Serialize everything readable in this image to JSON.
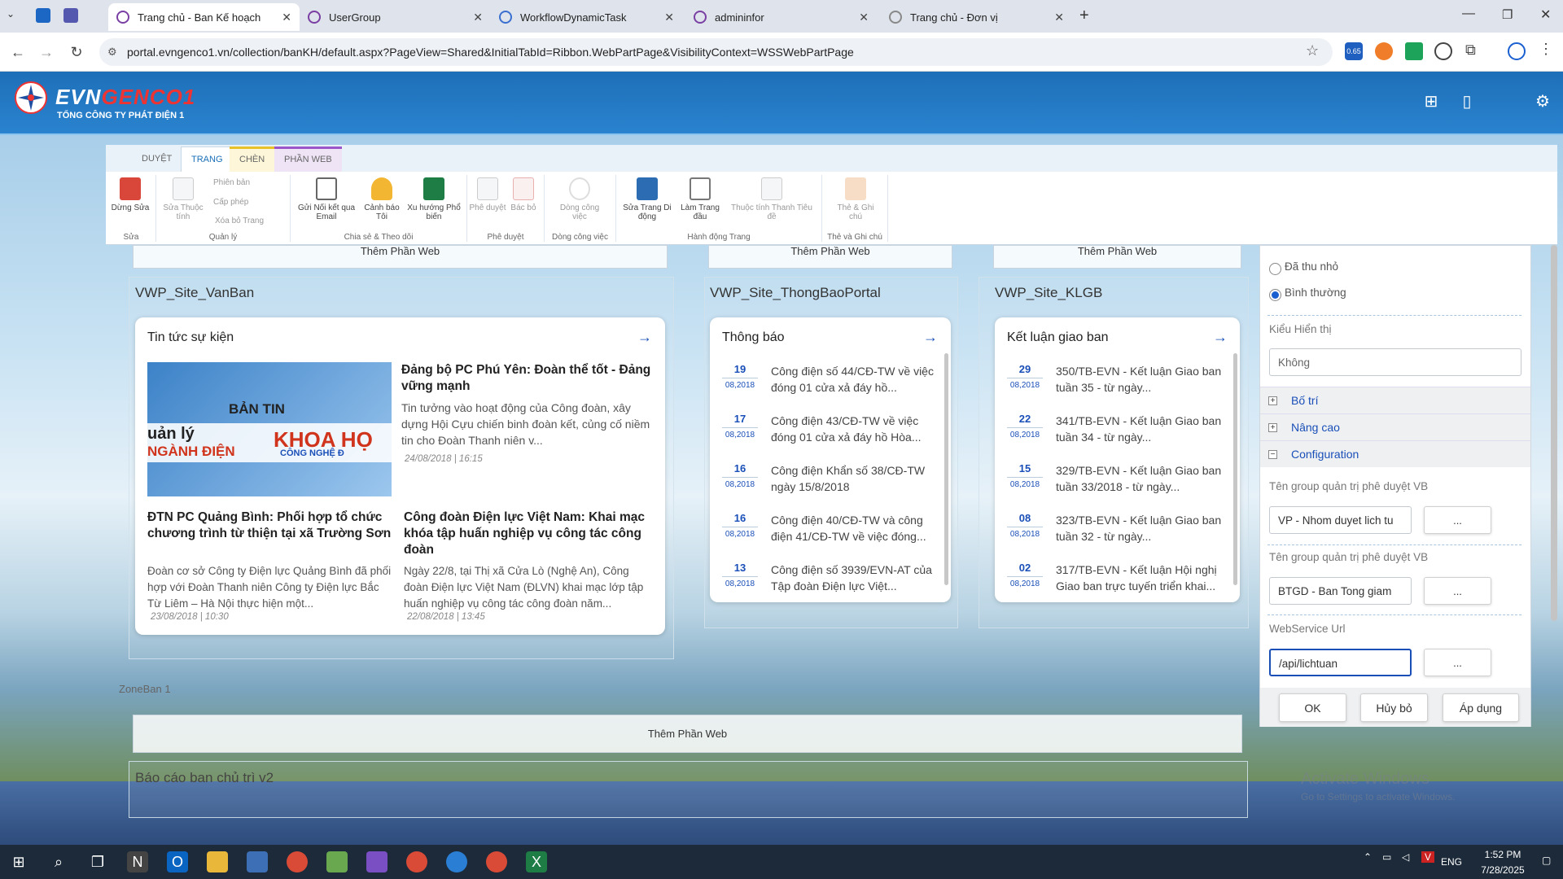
{
  "browser": {
    "tabs": [
      {
        "title": "Trang chủ - Ban Kế hoạch",
        "active": true
      },
      {
        "title": "UserGroup"
      },
      {
        "title": "WorkflowDynamicTask"
      },
      {
        "title": "admininfor"
      },
      {
        "title": "Trang chủ - Đơn vị"
      }
    ],
    "url": "portal.evngenco1.vn/collection/banKH/default.aspx?PageView=Shared&InitialTabId=Ribbon.WebPartPage&VisibilityContext=WSSWebPartPage",
    "ext_badge": "0.65"
  },
  "site": {
    "brand_a": "EVN",
    "brand_b": "GENCO1",
    "subtitle": "TỔNG CÔNG TY PHÁT ĐIỆN 1"
  },
  "ribbon": {
    "tabs": [
      "DUYỆT",
      "TRANG",
      "CHÈN",
      "PHẦN WEB"
    ],
    "buttons": {
      "stop_edit": "Dừng Sửa",
      "edit_props": "Sửa Thuộc tính",
      "version": "Phiên bản",
      "permission": "Cấp phép",
      "delete_page": "Xóa bỏ Trang",
      "email_link": "Gửi Nối kết qua Email",
      "alert_me": "Cảnh báo Tôi",
      "excel_pop": "Xu hướng Phổ biến",
      "approve": "Phê duyệt",
      "reject": "Bác bỏ",
      "workflow": "Dòng công việc",
      "edit_mobile": "Sửa Trang Di động",
      "make_home": "Làm Trang đầu",
      "title_bar": "Thuộc tính Thanh Tiêu đề",
      "tags_notes": "Thẻ & Ghi chú"
    },
    "groups": {
      "edit": "Sửa",
      "manage": "Quản lý",
      "share": "Chia sẻ & Theo dõi",
      "approval": "Phê duyệt",
      "workflow": "Dòng công việc",
      "page_actions": "Hành động Trang",
      "tags": "Thẻ và Ghi chú"
    }
  },
  "content": {
    "add_webpart": "Thêm Phần Web",
    "zone_label": "ZoneBan 1",
    "bottom_zone_title": "Báo cáo ban chủ trì v2",
    "vanban": {
      "zone_title": "VWP_Site_VanBan",
      "card_title": "Tin tức sự kiện",
      "banner_top": "BẢN TIN",
      "banner_left_1": "uản lý",
      "banner_left_2": "NGÀNH ĐIỆN",
      "banner_right_1": "KHOA HỌ",
      "banner_right_2": "CÔNG NGHỆ Đ",
      "featured": {
        "title": "Đảng bộ PC Phú Yên: Đoàn thể tốt - Đảng vững mạnh",
        "summary": "Tin tưởng vào hoạt động của Công đoàn, xây dựng Hội Cựu chiến binh đoàn kết, củng cố niềm tin cho Đoàn Thanh niên v...",
        "date": "24/08/2018 | 16:15"
      },
      "news": [
        {
          "title": "ĐTN PC Quảng Bình: Phối hợp tổ chức chương trình từ thiện tại xã Trường Sơn",
          "summary": "Đoàn cơ sở Công ty Điện lực Quảng Bình đã phối hợp với Đoàn Thanh niên Công ty Điện lực Bắc Từ Liêm – Hà Nội thực hiện một...",
          "date": "23/08/2018 | 10:30"
        },
        {
          "title": "Công đoàn Điện lực Việt Nam: Khai mạc khóa tập huấn nghiệp vụ công tác công đoàn",
          "summary": "Ngày 22/8, tại Thị xã Cửa Lò (Nghệ An), Công đoàn Điện lực Việt Nam (ĐLVN) khai mạc lớp tập huấn nghiệp vụ công tác công đoàn năm...",
          "date": "22/08/2018 | 13:45"
        }
      ]
    },
    "thongbao": {
      "zone_title": "VWP_Site_ThongBaoPortal",
      "card_title": "Thông báo",
      "items": [
        {
          "day": "19",
          "month": "08,2018",
          "text": "Công điện số 44/CĐ-TW về việc đóng 01 cửa xả đáy hồ..."
        },
        {
          "day": "17",
          "month": "08,2018",
          "text": "Công điện 43/CĐ-TW về việc đóng 01 cửa xả đáy hồ Hòa..."
        },
        {
          "day": "16",
          "month": "08,2018",
          "text": "Công điện Khẩn số 38/CĐ-TW ngày 15/8/2018"
        },
        {
          "day": "16",
          "month": "08,2018",
          "text": "Công điện 40/CĐ-TW và công điện 41/CĐ-TW về việc đóng..."
        },
        {
          "day": "13",
          "month": "08,2018",
          "text": "Công điện số 3939/EVN-AT của Tập đoàn Điện lực Việt..."
        }
      ]
    },
    "klgb": {
      "zone_title": "VWP_Site_KLGB",
      "card_title": "Kết luận giao ban",
      "items": [
        {
          "day": "29",
          "month": "08,2018",
          "text": "350/TB-EVN - Kết luận Giao ban tuần 35 - từ ngày..."
        },
        {
          "day": "22",
          "month": "08,2018",
          "text": "341/TB-EVN - Kết luận Giao ban tuần 34 - từ ngày..."
        },
        {
          "day": "15",
          "month": "08,2018",
          "text": "329/TB-EVN - Kết luận Giao ban tuần 33/2018 - từ ngày..."
        },
        {
          "day": "08",
          "month": "08,2018",
          "text": "323/TB-EVN - Kết luận Giao ban tuần 32 - từ ngày..."
        },
        {
          "day": "02",
          "month": "08,2018",
          "text": "317/TB-EVN - Kết luận Hội nghị Giao ban trực tuyến triển khai..."
        }
      ]
    }
  },
  "toolpane": {
    "radio_minimized": "Đã thu nhỏ",
    "radio_normal": "Bình thường",
    "display_type_label": "Kiểu Hiển thị",
    "display_type_value": "Không",
    "sections": {
      "layout": "Bố trí",
      "advanced": "Nâng cao",
      "config": "Configuration"
    },
    "group_label_1": "Tên group quản trị phê duyệt VB",
    "group_value_1": "VP - Nhom duyet lich tu",
    "group_label_2": "Tên group quản trị phê duyệt VB",
    "group_value_2": "BTGD - Ban Tong giam",
    "webservice_label": "WebService Url",
    "webservice_value": "/api/lichtuan",
    "browse": "...",
    "ok": "OK",
    "cancel": "Hủy bỏ",
    "apply": "Áp dụng"
  },
  "watermark": {
    "line1": "Activate Windows",
    "line2": "Go to Settings to activate Windows."
  },
  "taskbar": {
    "lang": "ENG",
    "time": "1:52 PM",
    "date": "7/28/2025"
  },
  "colors": {
    "header_blue": "#1e6fb8",
    "accent_red": "#e33333",
    "link_blue": "#1a4fb8"
  }
}
